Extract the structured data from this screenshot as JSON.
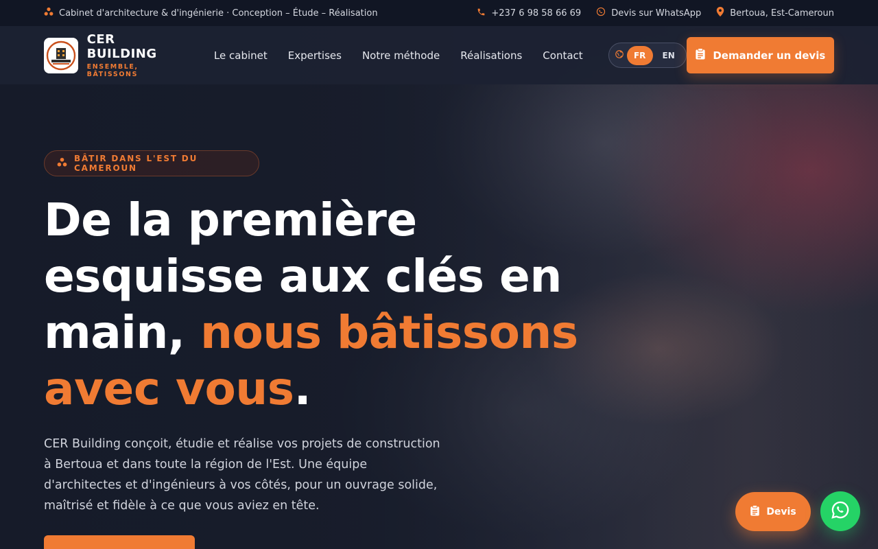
{
  "topbar": {
    "tagline": "Cabinet d'architecture & d'ingénierie · Conception – Étude – Réalisation",
    "phone": "+237 6 98 58 66 69",
    "whatsapp": "Devis sur WhatsApp",
    "location": "Bertoua, Est-Cameroun"
  },
  "brand": {
    "name": "CER BUILDING",
    "tagline": "ENSEMBLE, BÂTISSONS"
  },
  "nav": {
    "items": [
      {
        "label": "Le cabinet"
      },
      {
        "label": "Expertises"
      },
      {
        "label": "Notre méthode"
      },
      {
        "label": "Réalisations"
      },
      {
        "label": "Contact"
      }
    ],
    "lang": {
      "active": "FR",
      "other": "EN"
    },
    "cta": "Demander un devis"
  },
  "hero": {
    "badge": "BÂTIR DANS L'EST DU CAMEROUN",
    "headline_part1": "De la première esquisse aux clés en main, ",
    "headline_accent": "nous bâtissons avec vous",
    "headline_end": ".",
    "lead": "CER Building conçoit, étudie et réalise vos projets de construction à Bertoua et dans toute la région de l'Est. Une équipe d'architectes et d'ingénieurs à vos côtés, pour un ouvrage solide, maîtrisé et fidèle à ce que vous aviez en tête."
  },
  "floating": {
    "devis": "Devis"
  },
  "colors": {
    "accent": "#f07b33",
    "whatsapp": "#25d366",
    "dark": "#161b29"
  }
}
